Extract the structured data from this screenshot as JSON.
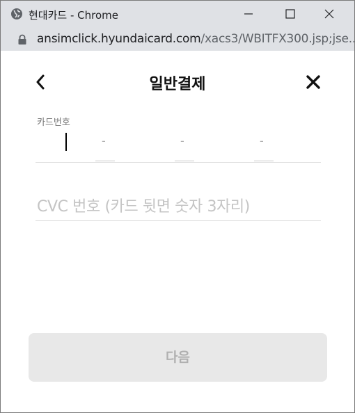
{
  "window": {
    "title": "현대카드 - Chrome",
    "url_host": "ansimclick.hyundaicard.com",
    "url_path": "/xacs3/WBITFX300.jsp;jse..."
  },
  "page": {
    "title": "일반결제",
    "card_number_label": "카드번호",
    "card_number_separator": "-",
    "cvc_placeholder": "CVC 번호 (카드 뒷면 숫자 3자리)",
    "next_button_label": "다음"
  },
  "icons": {
    "site": "globe-icon",
    "secure": "lock-icon",
    "back": "chevron-left-icon",
    "close": "close-icon"
  },
  "colors": {
    "titlebar_bg": "#dfe1e5",
    "disabled_button_bg": "#e8e8e8",
    "disabled_button_text": "#b0b0b0",
    "placeholder": "#c4c4c4"
  }
}
